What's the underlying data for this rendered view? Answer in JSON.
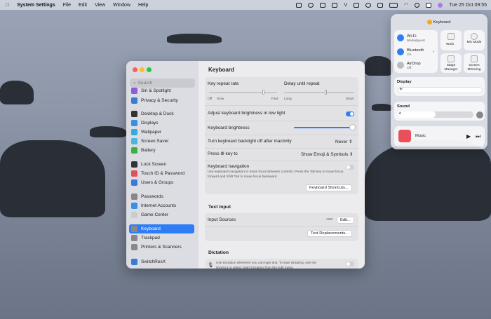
{
  "menubar": {
    "apple": "",
    "app_name": "System Settings",
    "items": [
      "File",
      "Edit",
      "View",
      "Window",
      "Help"
    ],
    "status_v": "V",
    "clock": "Tue 25 Oct  09:55"
  },
  "window": {
    "search_placeholder": "Search",
    "sidebar": [
      {
        "label": "Siri & Spotlight",
        "color": "#8e5bd9"
      },
      {
        "label": "Privacy & Security",
        "color": "#3a7bd5"
      },
      {
        "label": "Desktop & Dock",
        "color": "#333333"
      },
      {
        "label": "Displays",
        "color": "#3a8ee6"
      },
      {
        "label": "Wallpaper",
        "color": "#35aadc"
      },
      {
        "label": "Screen Saver",
        "color": "#4db6d8"
      },
      {
        "label": "Battery",
        "color": "#3cb043"
      },
      {
        "label": "Lock Screen",
        "color": "#333333"
      },
      {
        "label": "Touch ID & Password",
        "color": "#e0525b"
      },
      {
        "label": "Users & Groups",
        "color": "#3a7bd5"
      },
      {
        "label": "Passwords",
        "color": "#888888"
      },
      {
        "label": "Internet Accounts",
        "color": "#3a8ee6"
      },
      {
        "label": "Game Center",
        "color": "#cccccc"
      },
      {
        "label": "Keyboard",
        "color": "#888888"
      },
      {
        "label": "Trackpad",
        "color": "#888888"
      },
      {
        "label": "Printers & Scanners",
        "color": "#888888"
      },
      {
        "label": "SwitchResX",
        "color": "#3a7bd5"
      }
    ],
    "title": "Keyboard",
    "key_repeat": {
      "label": "Key repeat rate",
      "min": "Off",
      "slow": "Slow",
      "max": "Fast",
      "value_fraction": 0.8
    },
    "delay": {
      "label": "Delay until repeat",
      "min": "Long",
      "max": "Short",
      "value_fraction": 0.6
    },
    "adjust_brightness": {
      "label": "Adjust keyboard brightness in low light",
      "on": true
    },
    "brightness": {
      "label": "Keyboard brightness",
      "value_fraction": 1.0
    },
    "backlight_off": {
      "label": "Turn keyboard backlight off after inactivity",
      "value": "Never"
    },
    "press_key": {
      "label_pre": "Press",
      "label_post": "key to",
      "value": "Show Emoji & Symbols"
    },
    "nav": {
      "label": "Keyboard navigation",
      "desc": "Use keyboard navigation to move focus between controls. Press the Tab key to move focus forward and Shift Tab to move focus backward.",
      "on": false
    },
    "shortcuts_button": "Keyboard Shortcuts...",
    "text_input": {
      "heading": "Text Input",
      "label": "Input Sources",
      "value": "ABC",
      "edit": "Edit...",
      "replacements": "Text Replacements..."
    },
    "dictation": {
      "heading": "Dictation",
      "desc": "Use Dictation wherever you can type text. To start dictating, use the shortcut or select Start Dictation from the Edit menu.",
      "on": false
    }
  },
  "control_center": {
    "header": "Keyboard",
    "wifi": {
      "label": "Wi-Fi",
      "sub": "Medialguest"
    },
    "bluetooth": {
      "label": "Bluetooth",
      "sub": "On"
    },
    "airdrop": {
      "label": "AirDrop",
      "sub": "Off"
    },
    "work": "Work",
    "mic": "Mic Mode",
    "stage": "Stage Manager",
    "mirror": "Screen Mirroring",
    "display": {
      "label": "Display",
      "value_fraction": 0.02
    },
    "sound": {
      "label": "Sound",
      "value_fraction": 0.5
    },
    "music": "Music",
    "colors": {
      "blue": "#2e7df6",
      "orange": "#f5a623",
      "music": "#e8505b"
    }
  }
}
